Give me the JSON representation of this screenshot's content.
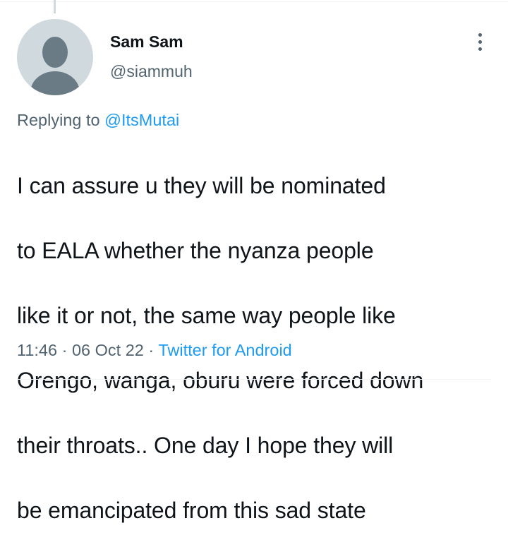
{
  "tweet": {
    "display_name": "Sam Sam",
    "handle": "@siammuh",
    "replying_prefix": "Replying to",
    "replying_to": "@ItsMutai",
    "text_lines": [
      "I can assure u they will be nominated",
      "to EALA whether the nyanza people",
      "like it or not, the same way people like",
      "Orengo, wanga, oburu were forced down",
      "their throats.. One day I hope they will",
      "be emancipated from this sad state"
    ],
    "time": "11:46",
    "separator": "·",
    "date": "06 Oct 22",
    "source": "Twitter for Android"
  },
  "icons": {
    "more": "more-vertical-icon",
    "avatar": "default-avatar-icon"
  },
  "colors": {
    "accent": "#1d9bf0",
    "secondary_text": "#536471",
    "avatar_bg": "#cfd9de"
  }
}
